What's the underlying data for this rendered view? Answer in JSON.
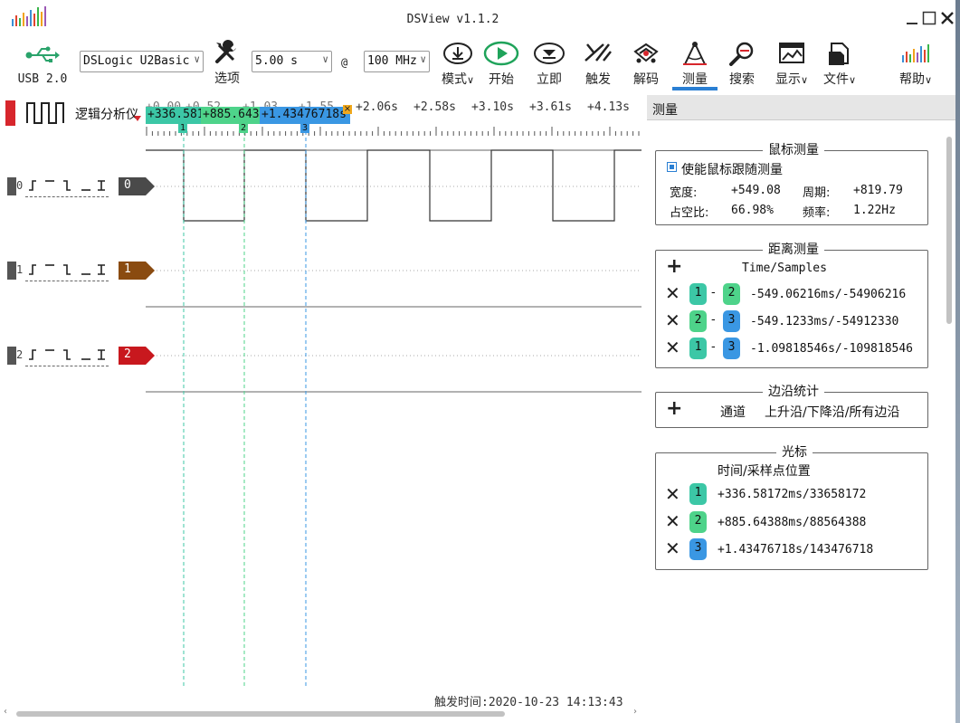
{
  "window": {
    "title": "DSView v1.1.2"
  },
  "toolbar": {
    "usb_label": "USB 2.0",
    "device": "DSLogic U2Basic",
    "options_label": "选项",
    "duration": "5.00 s",
    "at_sign": "@",
    "rate": "100 MHz",
    "mode_label": "模式",
    "start_label": "开始",
    "instant_label": "立即",
    "trigger_label": "触发",
    "decode_label": "解码",
    "measure_label": "测量",
    "search_label": "搜索",
    "display_label": "显示",
    "file_label": "文件",
    "help_label": "帮助"
  },
  "scope": {
    "mode_title": "逻辑分析仪",
    "ruler_ticks": [
      "+2.06s",
      "+2.58s",
      "+3.10s",
      "+3.61s",
      "+4.13s"
    ],
    "ruler_partial": [
      "+0.00",
      "+0.52",
      "+1.03",
      "+1.55"
    ],
    "cursors": [
      {
        "id": "1",
        "value": "+336.581",
        "color": "#3cc7a6"
      },
      {
        "id": "2",
        "value": "+885.643",
        "color": "#4ed38a"
      },
      {
        "id": "3",
        "value": "+1.43476718s",
        "color": "#3a97e3"
      }
    ],
    "close_glyph": "×",
    "channels": [
      {
        "index": "0",
        "tag": "0",
        "trigger": "⎍ ̄ ⎍ _ ⊥",
        "color": "#4a4a4a"
      },
      {
        "index": "1",
        "tag": "1",
        "trigger": "⎍ ̄ ⎍ _ ⊥",
        "color": "#8a4b10"
      },
      {
        "index": "2",
        "tag": "2",
        "trigger": "⎍ ̄ ⎍ _ ⊥",
        "color": "#c8181e"
      }
    ],
    "trigger_time": "触发时间:2020-10-23 14:13:43"
  },
  "panel": {
    "title": "测量",
    "mouse": {
      "title": "鼠标测量",
      "enable_label": "使能鼠标跟随测量",
      "width_label": "宽度:",
      "width_value": "+549.08",
      "period_label": "周期:",
      "period_value": "+819.79",
      "duty_label": "占空比:",
      "duty_value": "66.98%",
      "freq_label": "频率:",
      "freq_value": "1.22Hz"
    },
    "distance": {
      "title": "距离测量",
      "header": "Time/Samples",
      "rows": [
        {
          "a": "1",
          "b": "2",
          "a_color": "#3cc7a6",
          "b_color": "#4ed38a",
          "value": "-549.06216ms/-54906216"
        },
        {
          "a": "2",
          "b": "3",
          "a_color": "#4ed38a",
          "b_color": "#3a97e3",
          "value": "-549.1233ms/-54912330"
        },
        {
          "a": "1",
          "b": "3",
          "a_color": "#3cc7a6",
          "b_color": "#3a97e3",
          "value": "-1.09818546s/-109818546"
        }
      ],
      "dash": "-"
    },
    "edges": {
      "title": "边沿统计",
      "channel_label": "通道",
      "edge_label": "上升沿/下降沿/所有边沿"
    },
    "cursors": {
      "title": "光标",
      "header": "时间/采样点位置",
      "rows": [
        {
          "id": "1",
          "color": "#3cc7a6",
          "value": "+336.58172ms/33658172"
        },
        {
          "id": "2",
          "color": "#4ed38a",
          "value": "+885.64388ms/88564388"
        },
        {
          "id": "3",
          "color": "#3a97e3",
          "value": "+1.43476718s/143476718"
        }
      ]
    }
  }
}
